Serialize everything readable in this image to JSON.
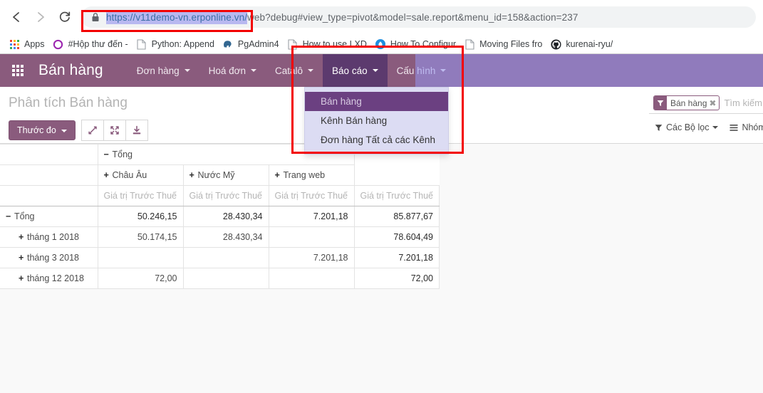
{
  "browser": {
    "back_label": "Back",
    "forward_label": "Forward",
    "reload_label": "Reload",
    "url_selected": "https://v11demo-vn.erponline.vn/",
    "url_rest": "web?debug#view_type=pivot&model=sale.report&menu_id=158&action=237",
    "url_full": "https://v11demo-vn.erponline.vn/web?debug#view_type=pivot&model=sale.report&menu_id=158&action=237",
    "lock_icon": "lock-icon",
    "bookmarks": [
      {
        "label": "Apps",
        "icon": "apps-grid-icon"
      },
      {
        "label": "#Hộp thư đến - ",
        "icon": "circle-o-icon"
      },
      {
        "label": "Python: Append",
        "icon": "page-icon"
      },
      {
        "label": "PgAdmin4",
        "icon": "elephant-icon"
      },
      {
        "label": "How to use LXD",
        "icon": "page-icon"
      },
      {
        "label": "How To Configur",
        "icon": "droplet-icon"
      },
      {
        "label": "Moving Files fro",
        "icon": "page-icon"
      },
      {
        "label": "kurenai-ryu/",
        "icon": "github-icon"
      }
    ]
  },
  "odoo": {
    "apps_icon": "apps-grid-icon",
    "brand": "Bán hàng",
    "menu": [
      {
        "label": "Đơn hàng",
        "active": false
      },
      {
        "label": "Hoá đơn",
        "active": false
      },
      {
        "label": "Catalô",
        "active": false
      },
      {
        "label": "Báo cáo",
        "active": true
      },
      {
        "label": "Cấu hình",
        "active": false
      }
    ],
    "dropdown": {
      "items": [
        {
          "label": "Bán hàng",
          "selected": true
        },
        {
          "label": "Kênh Bán hàng",
          "selected": false
        },
        {
          "label": "Đơn hàng Tất cả các Kênh",
          "selected": false
        }
      ]
    },
    "control_panel": {
      "title": "Phân tích Bán hàng",
      "measure_button": "Thước đo",
      "icon_buttons": [
        {
          "name": "expand-diagonal-icon"
        },
        {
          "name": "arrows-alt-icon"
        },
        {
          "name": "download-icon"
        }
      ],
      "search": {
        "facet_label": "Bán hàng",
        "facet_icon": "filter-icon",
        "facet_remove": "✖",
        "placeholder": "Tìm kiếm..."
      },
      "filters_button": "Các Bộ lọc",
      "groupby_button": "Nhóm"
    },
    "pivot": {
      "col_group_total": "Tổng",
      "columns": [
        {
          "label": "Châu Âu",
          "toggle": "+"
        },
        {
          "label": "Nước Mỹ",
          "toggle": "+"
        },
        {
          "label": "Trang web",
          "toggle": "+"
        }
      ],
      "measure_label": "Giá trị Trước Thuế",
      "rows": [
        {
          "label": "Tổng",
          "toggle": "−",
          "level": 0,
          "bold": true,
          "values": [
            "50.246,15",
            "28.430,34",
            "7.201,18"
          ],
          "total": "85.877,67"
        },
        {
          "label": "tháng 1 2018",
          "toggle": "+",
          "level": 1,
          "bold": false,
          "values": [
            "50.174,15",
            "28.430,34",
            ""
          ],
          "total": "78.604,49"
        },
        {
          "label": "tháng 3 2018",
          "toggle": "+",
          "level": 1,
          "bold": false,
          "values": [
            "",
            "",
            "7.201,18"
          ],
          "total": "7.201,18"
        },
        {
          "label": "tháng 12 2018",
          "toggle": "+",
          "level": 1,
          "bold": false,
          "values": [
            "72,00",
            "",
            ""
          ],
          "total": "72,00"
        }
      ]
    }
  },
  "annotations": {
    "url_box_color": "#f30000",
    "menu_box_color": "#f30000"
  },
  "colors": {
    "navbar": "#8a5b7d",
    "menu_active": "#5c3a6e",
    "dropdown_bg": "#dcdcf3",
    "dropdown_selected": "#6b4081",
    "accent": "#8a5b7d"
  }
}
